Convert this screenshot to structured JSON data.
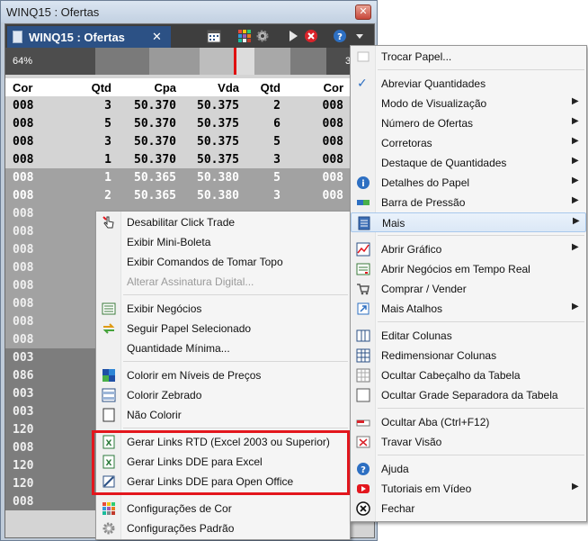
{
  "window": {
    "title": "WINQ15 : Ofertas",
    "close_glyph": "✕"
  },
  "tab": {
    "label": "WINQ15 : Ofertas",
    "close_glyph": "✕"
  },
  "toolbar": {
    "icons": [
      "calendar-icon",
      "color-grid-icon",
      "gear-icon",
      "play-icon",
      "stop-icon",
      "help-icon",
      "dropdown-icon"
    ]
  },
  "pressure_bar": {
    "left_percent": "64%",
    "right_percent_partial": "3"
  },
  "book": {
    "columns": [
      "Cor",
      "Qtd",
      "Cpa",
      "Vda",
      "Qtd",
      "Cor"
    ],
    "rows": [
      {
        "c1": "008",
        "q1": "3",
        "cpa": "50.370",
        "vda": "50.375",
        "q2": "2",
        "c2": "008",
        "tone": "light"
      },
      {
        "c1": "008",
        "q1": "5",
        "cpa": "50.370",
        "vda": "50.375",
        "q2": "6",
        "c2": "008",
        "tone": "light"
      },
      {
        "c1": "008",
        "q1": "3",
        "cpa": "50.370",
        "vda": "50.375",
        "q2": "5",
        "c2": "008",
        "tone": "light"
      },
      {
        "c1": "008",
        "q1": "1",
        "cpa": "50.370",
        "vda": "50.375",
        "q2": "3",
        "c2": "008",
        "tone": "light"
      },
      {
        "c1": "008",
        "q1": "1",
        "cpa": "50.365",
        "vda": "50.380",
        "q2": "5",
        "c2": "008",
        "tone": "mid"
      },
      {
        "c1": "008",
        "q1": "2",
        "cpa": "50.365",
        "vda": "50.380",
        "q2": "3",
        "c2": "008",
        "tone": "mid"
      }
    ],
    "left_col_rest": [
      "008",
      "008",
      "008",
      "008",
      "008",
      "008",
      "008",
      "008",
      "003",
      "086",
      "003",
      "003",
      "120",
      "008",
      "120",
      "120",
      "008"
    ]
  },
  "left_menu": {
    "items": [
      {
        "id": "disable-click-trade",
        "label": "Desabilitar Click Trade",
        "icon": "hand-cursor-icon"
      },
      {
        "id": "mini-boleta",
        "label": "Exibir Mini-Boleta"
      },
      {
        "id": "top-commands",
        "label": "Exibir Comandos de Tomar Topo"
      },
      {
        "id": "digital-signature",
        "label": "Alterar Assinatura Digital...",
        "disabled": true
      },
      {
        "id": "show-trades",
        "label": "Exibir Negócios",
        "icon": "trades-list-icon"
      },
      {
        "id": "follow-paper",
        "label": "Seguir Papel Selecionado",
        "icon": "sync-arrows-icon"
      },
      {
        "id": "min-qty",
        "label": "Quantidade Mínima..."
      },
      {
        "id": "color-levels",
        "label": "Colorir em Níveis de Preços",
        "icon": "color-levels-icon"
      },
      {
        "id": "color-zebra",
        "label": "Colorir Zebrado",
        "icon": "zebra-icon"
      },
      {
        "id": "no-color",
        "label": "Não Colorir",
        "icon": "blank-square-icon"
      },
      {
        "id": "rtd-links",
        "label": "Gerar Links RTD (Excel 2003 ou Superior)",
        "icon": "excel-icon"
      },
      {
        "id": "dde-excel",
        "label": "Gerar Links DDE para Excel",
        "icon": "excel-icon"
      },
      {
        "id": "dde-openoffice",
        "label": "Gerar Links DDE para Open Office",
        "icon": "openoffice-icon"
      },
      {
        "id": "color-config",
        "label": "Configurações de Cor",
        "icon": "palette-icon"
      },
      {
        "id": "default-config",
        "label": "Configurações Padrão",
        "icon": "gear-icon"
      }
    ]
  },
  "right_menu": {
    "items": [
      {
        "id": "trocar-papel",
        "label": "Trocar Papel...",
        "icon": "blank-icon"
      },
      {
        "id": "abreviar",
        "label": "Abreviar Quantidades",
        "checked": true
      },
      {
        "id": "modo-vis",
        "label": "Modo de Visualização",
        "submenu": true
      },
      {
        "id": "num-ofertas",
        "label": "Número de Ofertas",
        "submenu": true
      },
      {
        "id": "corretoras",
        "label": "Corretoras",
        "submenu": true
      },
      {
        "id": "destaque",
        "label": "Destaque de Quantidades",
        "submenu": true
      },
      {
        "id": "detalhes",
        "label": "Detalhes do Papel",
        "submenu": true,
        "icon": "info-icon"
      },
      {
        "id": "barra-pressao",
        "label": "Barra de Pressão",
        "submenu": true,
        "icon": "pressure-bar-icon"
      },
      {
        "id": "mais",
        "label": "Mais",
        "submenu": true,
        "icon": "more-icon",
        "highlighted": true
      },
      {
        "id": "abrir-grafico",
        "label": "Abrir Gráfico",
        "submenu": true,
        "icon": "chart-icon"
      },
      {
        "id": "negocios-tr",
        "label": "Abrir Negócios em Tempo Real",
        "icon": "realtime-trades-icon"
      },
      {
        "id": "comprar-vender",
        "label": "Comprar / Vender",
        "icon": "cart-icon"
      },
      {
        "id": "atalhos",
        "label": "Mais Atalhos",
        "submenu": true,
        "icon": "shortcut-icon"
      },
      {
        "id": "editar-colunas",
        "label": "Editar Colunas",
        "icon": "edit-columns-icon"
      },
      {
        "id": "redim-colunas",
        "label": "Redimensionar Colunas",
        "icon": "resize-columns-icon"
      },
      {
        "id": "ocultar-cab",
        "label": "Ocultar Cabeçalho da Tabela",
        "icon": "table-header-icon"
      },
      {
        "id": "ocultar-grade",
        "label": "Ocultar Grade Separadora da Tabela",
        "icon": "table-grid-icon"
      },
      {
        "id": "ocultar-aba",
        "label": "Ocultar Aba (Ctrl+F12)",
        "icon": "tab-icon"
      },
      {
        "id": "travar",
        "label": "Travar Visão",
        "icon": "lock-view-icon"
      },
      {
        "id": "ajuda",
        "label": "Ajuda",
        "icon": "help-icon"
      },
      {
        "id": "tutoriais",
        "label": "Tutoriais em Vídeo",
        "submenu": true,
        "icon": "youtube-icon"
      },
      {
        "id": "fechar",
        "label": "Fechar",
        "icon": "close-circle-icon"
      }
    ]
  },
  "glyphs": {
    "checkmark": "✓",
    "submenu_arrow": "▶"
  },
  "colors": {
    "tab_blue": "#2c5185",
    "highlight_red": "#e3161d",
    "pressure_marker": "#e01010"
  }
}
